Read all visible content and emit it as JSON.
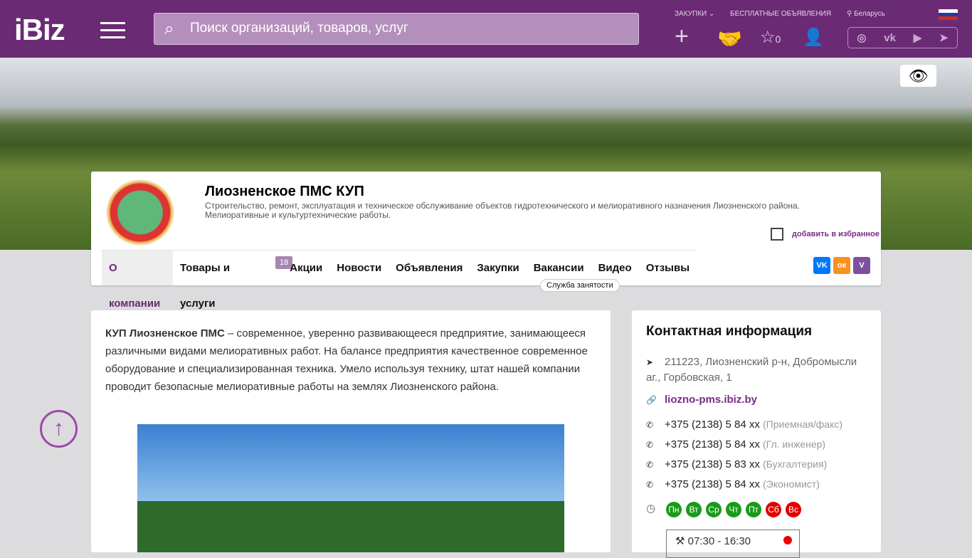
{
  "header": {
    "logo": "iBiz",
    "search_placeholder": "Поиск организаций, товаров, услуг",
    "procurement": "ЗАКУПКИ",
    "free_ads": "БЕСПЛАТНЫЕ ОБЪЯВЛЕНИЯ",
    "region": "Беларусь",
    "favorites_count": "0"
  },
  "company": {
    "name": "Лиозненское ПМС КУП",
    "description": "Строительство, ремонт, эксплуатация и техническое обслуживание объектов гидротехнического и мелиоративного назначения Лиозненского района. Мелиоративные и культуртехнические работы.",
    "add_favorite": "добавить в избранное"
  },
  "tabs": [
    {
      "label": "О компании"
    },
    {
      "label": "Товары и услуги",
      "badge": "18"
    },
    {
      "label": "Акции"
    },
    {
      "label": "Новости"
    },
    {
      "label": "Объявления"
    },
    {
      "label": "Закупки"
    },
    {
      "label": "Вакансии"
    },
    {
      "label": "Видео"
    },
    {
      "label": "Отзывы"
    }
  ],
  "employment_tag": "Служба занятости",
  "share": {
    "vk": "VK",
    "ok": "ок",
    "viber": "V"
  },
  "about": {
    "bold": "КУП Лиозненское ПМС",
    "text": " – современное, уверенно развивающееся предприятие, занимающееся различными видами мелиоративных работ. На балансе предприятия качественное современное оборудование и специализированная техника. Умело используя технику, штат нашей компании проводит безопасные мелиоративные работы на землях Лиозненского района."
  },
  "contacts": {
    "title": "Контактная информация",
    "address": "211223, Лиозненский р-н, Добромысли аг., Горбовская, 1",
    "website": "liozno-pms.ibiz.by",
    "phones": [
      {
        "number": "+375 (2138) 5 84 xx",
        "note": "(Приемная/факс)"
      },
      {
        "number": "+375 (2138) 5 84 xx",
        "note": "(Гл. инженер)"
      },
      {
        "number": "+375 (2138) 5 83 xx",
        "note": "(Бухгалтерия)"
      },
      {
        "number": "+375 (2138) 5 84 xx",
        "note": "(Экономист)"
      }
    ],
    "days": [
      {
        "d": "Пн",
        "color": "#1a9a1a"
      },
      {
        "d": "Вт",
        "color": "#1a9a1a"
      },
      {
        "d": "Ср",
        "color": "#1a9a1a"
      },
      {
        "d": "Чт",
        "color": "#1a9a1a"
      },
      {
        "d": "Пт",
        "color": "#1a9a1a"
      },
      {
        "d": "Сб",
        "color": "#e00000"
      },
      {
        "d": "Вс",
        "color": "#e00000"
      }
    ],
    "hours": "07:30 - 16:30"
  }
}
